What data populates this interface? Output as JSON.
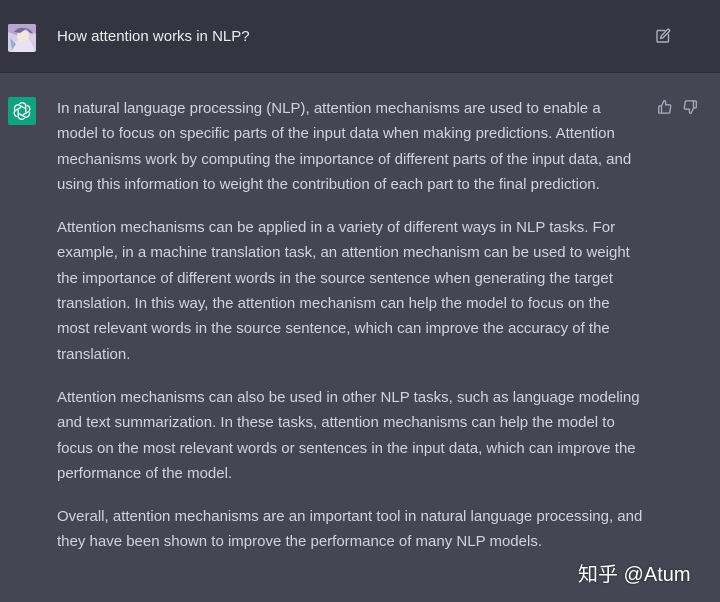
{
  "user_message": {
    "text": "How attention works in NLP?",
    "avatar_icon": "user-avatar-anime",
    "edit_icon": "edit-icon"
  },
  "assistant_message": {
    "avatar_icon": "openai-logo-icon",
    "avatar_color": "#10a37f",
    "paragraphs": [
      "In natural language processing (NLP), attention mechanisms are used to enable a model to focus on specific parts of the input data when making predictions. Attention mechanisms work by computing the importance of different parts of the input data, and using this information to weight the contribution of each part to the final prediction.",
      "Attention mechanisms can be applied in a variety of different ways in NLP tasks. For example, in a machine translation task, an attention mechanism can be used to weight the importance of different words in the source sentence when generating the target translation. In this way, the attention mechanism can help the model to focus on the most relevant words in the source sentence, which can improve the accuracy of the translation.",
      "Attention mechanisms can also be used in other NLP tasks, such as language modeling and text summarization. In these tasks, attention mechanisms can help the model to focus on the most relevant words or sentences in the input data, which can improve the performance of the model.",
      "Overall, attention mechanisms are an important tool in natural language processing, and they have been shown to improve the performance of many NLP models."
    ],
    "feedback": {
      "thumbs_up_icon": "thumbs-up-icon",
      "thumbs_down_icon": "thumbs-down-icon"
    }
  },
  "watermark": {
    "text": "知乎 @Atum"
  },
  "colors": {
    "user_bg": "#343541",
    "assistant_bg": "#444654",
    "text": "#d1d5db",
    "accent": "#10a37f"
  }
}
